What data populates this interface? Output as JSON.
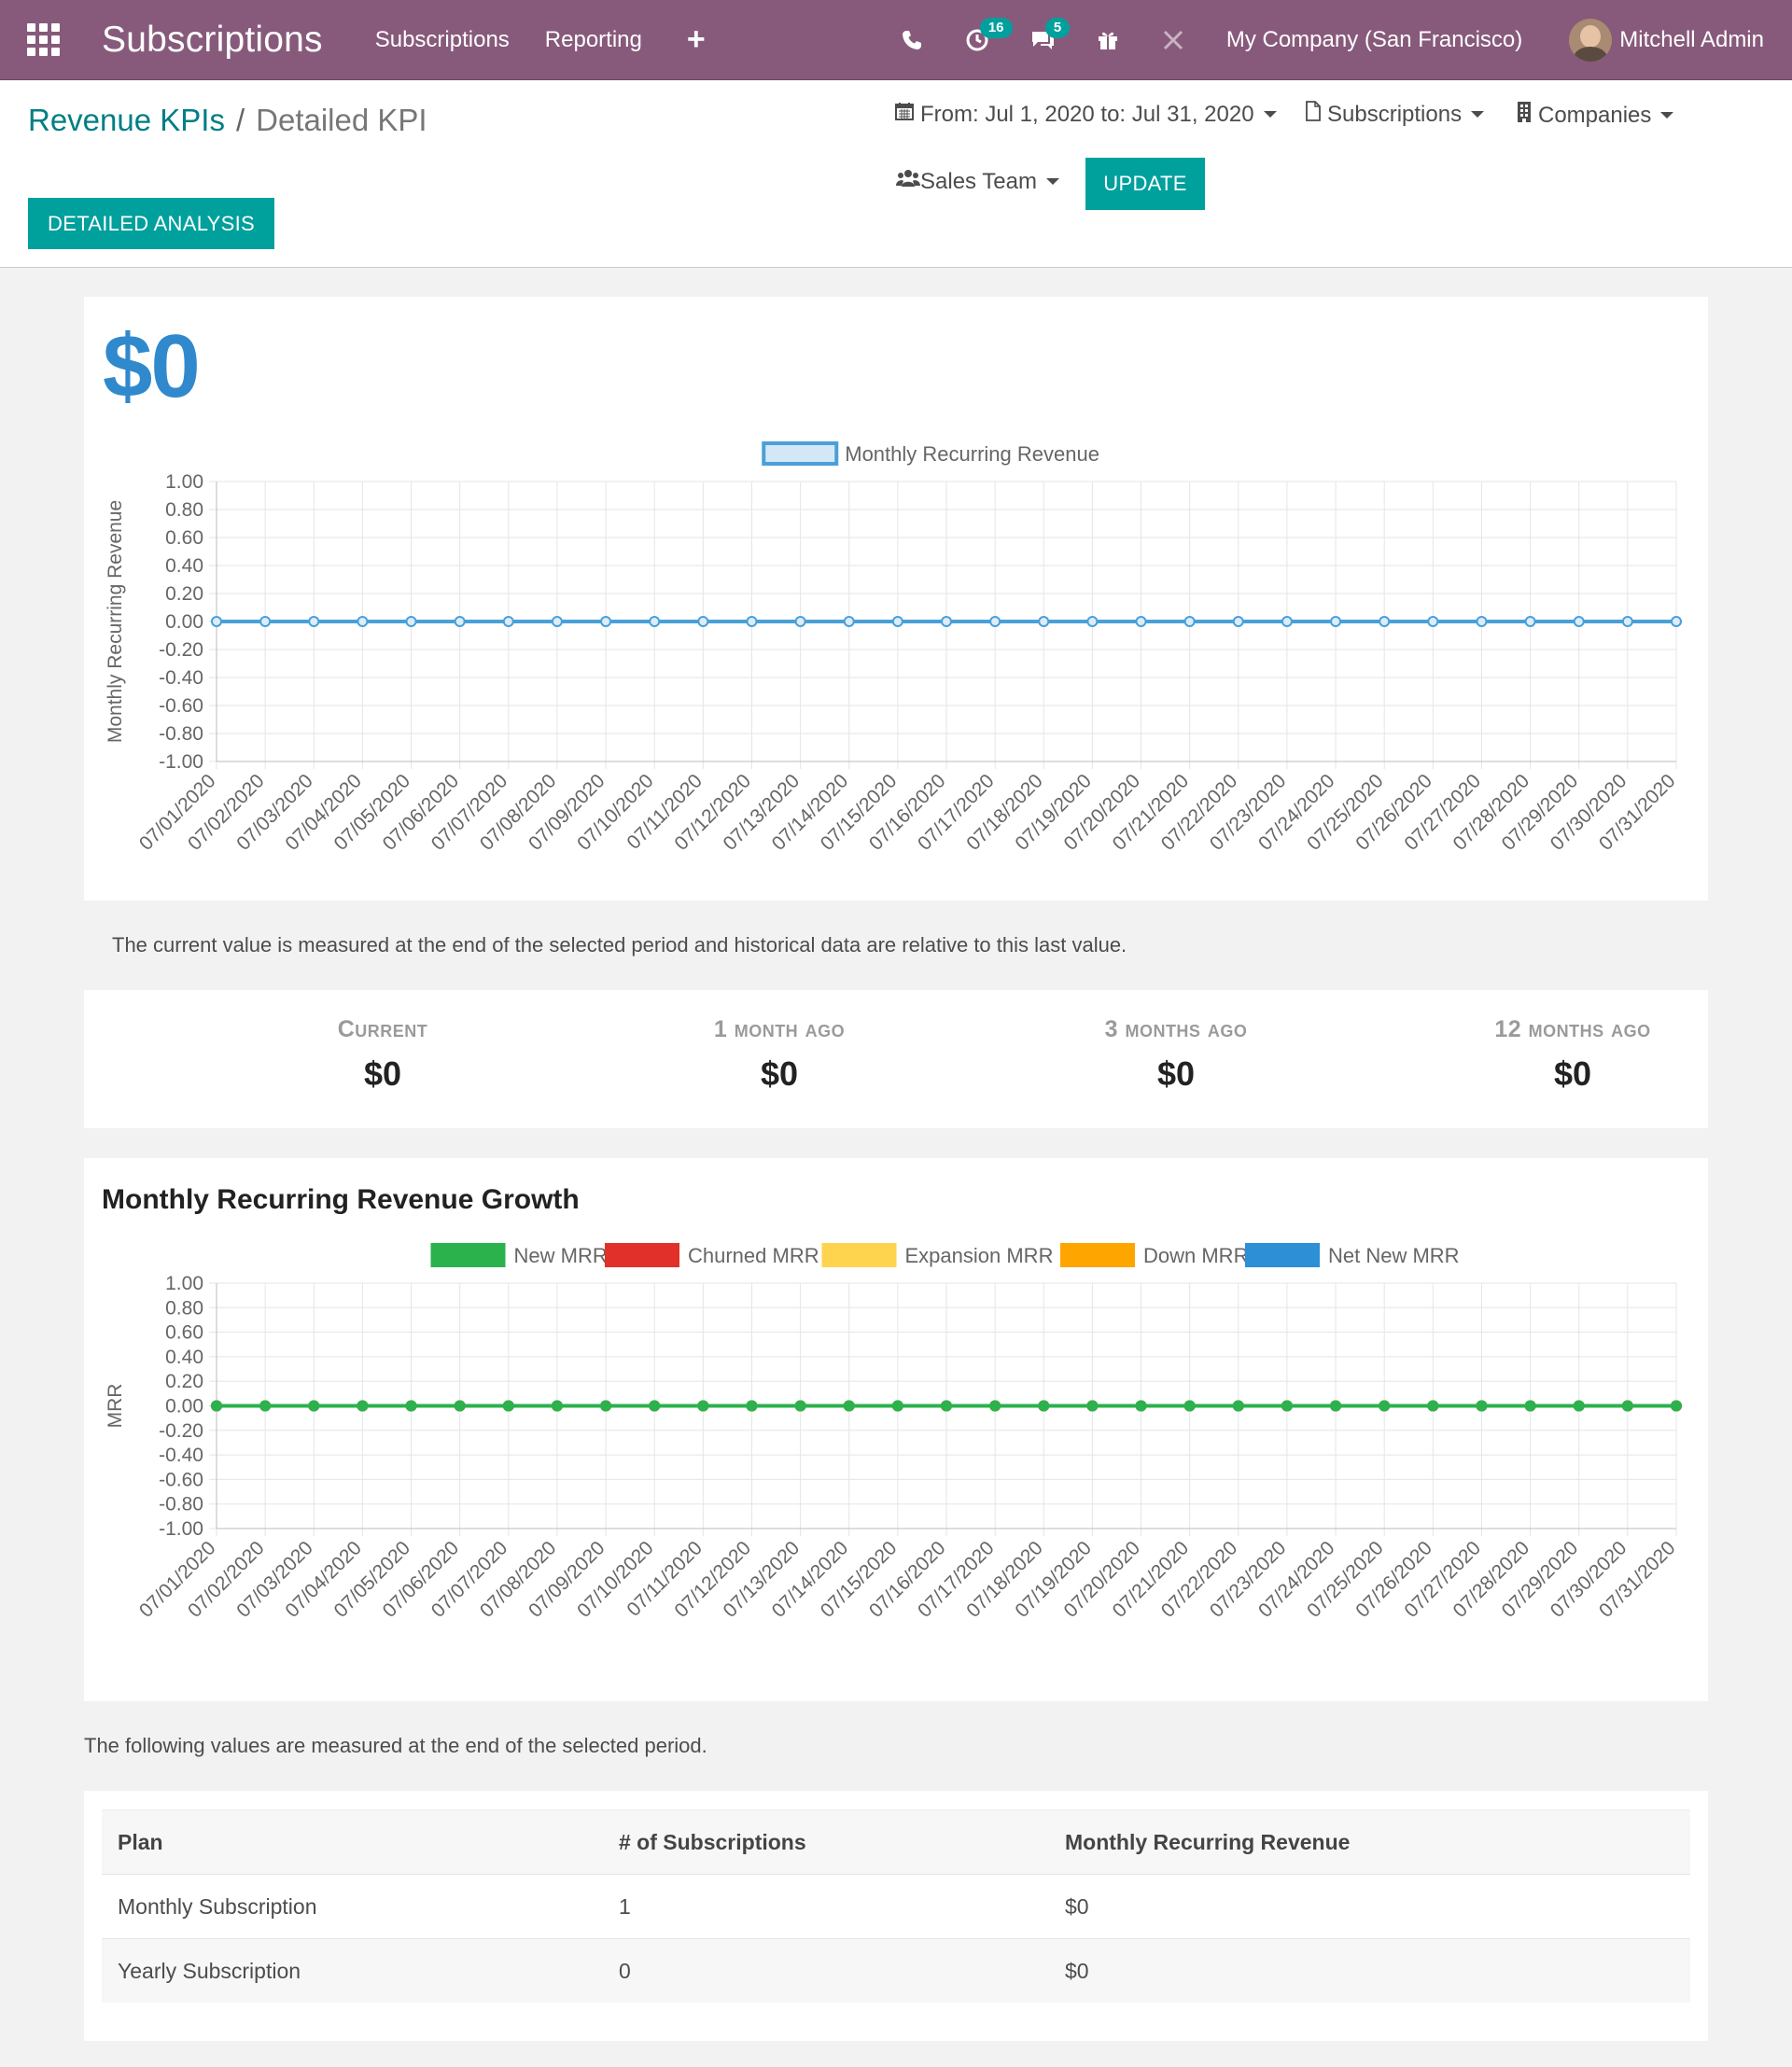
{
  "navbar": {
    "app_title": "Subscriptions",
    "menu": [
      "Subscriptions",
      "Reporting"
    ],
    "plus_icon": "+",
    "activity_count": "16",
    "messages_count": "5",
    "company": "My Company (San Francisco)",
    "user": "Mitchell Admin"
  },
  "breadcrumb": {
    "parent": "Revenue KPIs",
    "separator": "/",
    "current": "Detailed KPI"
  },
  "controls": {
    "date_filter": "From: Jul 1, 2020 to: Jul 31, 2020",
    "subscriptions_filter": "Subscriptions",
    "companies_filter": "Companies",
    "sales_team_filter": "Sales Team",
    "update_button": "Update",
    "detailed_analysis_button": "Detailed Analysis"
  },
  "kpi": {
    "current_value": "$0",
    "note": "The current value is measured at the end of the selected period and historical data are relative to this last value.",
    "history": [
      {
        "label": "Current",
        "value": "$0"
      },
      {
        "label": "1 month ago",
        "value": "$0"
      },
      {
        "label": "3 months ago",
        "value": "$0"
      },
      {
        "label": "12 months ago",
        "value": "$0"
      }
    ]
  },
  "growth": {
    "title": "Monthly Recurring Revenue Growth"
  },
  "table": {
    "note": "The following values are measured at the end of the selected period.",
    "headers": [
      "Plan",
      "# of Subscriptions",
      "Monthly Recurring Revenue"
    ],
    "rows": [
      [
        "Monthly Subscription",
        "1",
        "$0"
      ],
      [
        "Yearly Subscription",
        "0",
        "$0"
      ]
    ]
  },
  "chart_data": [
    {
      "type": "line",
      "title": "",
      "ylabel": "Monthly Recurring Revenue",
      "xlabel": "",
      "ylim": [
        -1,
        1
      ],
      "yticks": [
        "1.00",
        "0.80",
        "0.60",
        "0.40",
        "0.20",
        "0.00",
        "-0.20",
        "-0.40",
        "-0.60",
        "-0.80",
        "-1.00"
      ],
      "categories": [
        "07/01/2020",
        "07/02/2020",
        "07/03/2020",
        "07/04/2020",
        "07/05/2020",
        "07/06/2020",
        "07/07/2020",
        "07/08/2020",
        "07/09/2020",
        "07/10/2020",
        "07/11/2020",
        "07/12/2020",
        "07/13/2020",
        "07/14/2020",
        "07/15/2020",
        "07/16/2020",
        "07/17/2020",
        "07/18/2020",
        "07/19/2020",
        "07/20/2020",
        "07/21/2020",
        "07/22/2020",
        "07/23/2020",
        "07/24/2020",
        "07/25/2020",
        "07/26/2020",
        "07/27/2020",
        "07/28/2020",
        "07/29/2020",
        "07/30/2020",
        "07/31/2020"
      ],
      "series": [
        {
          "name": "Monthly Recurring Revenue",
          "color": "#4aa0d8",
          "fill": "#d4e7f6",
          "values": [
            0,
            0,
            0,
            0,
            0,
            0,
            0,
            0,
            0,
            0,
            0,
            0,
            0,
            0,
            0,
            0,
            0,
            0,
            0,
            0,
            0,
            0,
            0,
            0,
            0,
            0,
            0,
            0,
            0,
            0,
            0
          ]
        }
      ],
      "grid": true,
      "legend": "top-center"
    },
    {
      "type": "line",
      "title": "",
      "ylabel": "MRR",
      "xlabel": "",
      "ylim": [
        -1,
        1
      ],
      "yticks": [
        "1.00",
        "0.80",
        "0.60",
        "0.40",
        "0.20",
        "0.00",
        "-0.20",
        "-0.40",
        "-0.60",
        "-0.80",
        "-1.00"
      ],
      "categories": [
        "07/01/2020",
        "07/02/2020",
        "07/03/2020",
        "07/04/2020",
        "07/05/2020",
        "07/06/2020",
        "07/07/2020",
        "07/08/2020",
        "07/09/2020",
        "07/10/2020",
        "07/11/2020",
        "07/12/2020",
        "07/13/2020",
        "07/14/2020",
        "07/15/2020",
        "07/16/2020",
        "07/17/2020",
        "07/18/2020",
        "07/19/2020",
        "07/20/2020",
        "07/21/2020",
        "07/22/2020",
        "07/23/2020",
        "07/24/2020",
        "07/25/2020",
        "07/26/2020",
        "07/27/2020",
        "07/28/2020",
        "07/29/2020",
        "07/30/2020",
        "07/31/2020"
      ],
      "series": [
        {
          "name": "New MRR",
          "color": "#2bb24c",
          "values": [
            0,
            0,
            0,
            0,
            0,
            0,
            0,
            0,
            0,
            0,
            0,
            0,
            0,
            0,
            0,
            0,
            0,
            0,
            0,
            0,
            0,
            0,
            0,
            0,
            0,
            0,
            0,
            0,
            0,
            0,
            0
          ]
        },
        {
          "name": "Churned MRR",
          "color": "#e1302a",
          "values": [
            0,
            0,
            0,
            0,
            0,
            0,
            0,
            0,
            0,
            0,
            0,
            0,
            0,
            0,
            0,
            0,
            0,
            0,
            0,
            0,
            0,
            0,
            0,
            0,
            0,
            0,
            0,
            0,
            0,
            0,
            0
          ]
        },
        {
          "name": "Expansion MRR",
          "color": "#fed44f",
          "values": [
            0,
            0,
            0,
            0,
            0,
            0,
            0,
            0,
            0,
            0,
            0,
            0,
            0,
            0,
            0,
            0,
            0,
            0,
            0,
            0,
            0,
            0,
            0,
            0,
            0,
            0,
            0,
            0,
            0,
            0,
            0
          ]
        },
        {
          "name": "Down MRR",
          "color": "#ffa500",
          "values": [
            0,
            0,
            0,
            0,
            0,
            0,
            0,
            0,
            0,
            0,
            0,
            0,
            0,
            0,
            0,
            0,
            0,
            0,
            0,
            0,
            0,
            0,
            0,
            0,
            0,
            0,
            0,
            0,
            0,
            0,
            0
          ]
        },
        {
          "name": "Net New MRR",
          "color": "#2d8fd5",
          "values": [
            0,
            0,
            0,
            0,
            0,
            0,
            0,
            0,
            0,
            0,
            0,
            0,
            0,
            0,
            0,
            0,
            0,
            0,
            0,
            0,
            0,
            0,
            0,
            0,
            0,
            0,
            0,
            0,
            0,
            0,
            0
          ]
        }
      ],
      "grid": true,
      "legend": "top-center"
    }
  ],
  "icons": {
    "apps": "apps-grid-icon",
    "phone": "phone-icon",
    "activity": "clock-icon",
    "messages": "chat-icon",
    "gift": "gift-icon",
    "debug": "tools-icon",
    "calendar": "calendar-icon",
    "document": "document-icon",
    "building": "building-icon",
    "users": "users-icon"
  }
}
